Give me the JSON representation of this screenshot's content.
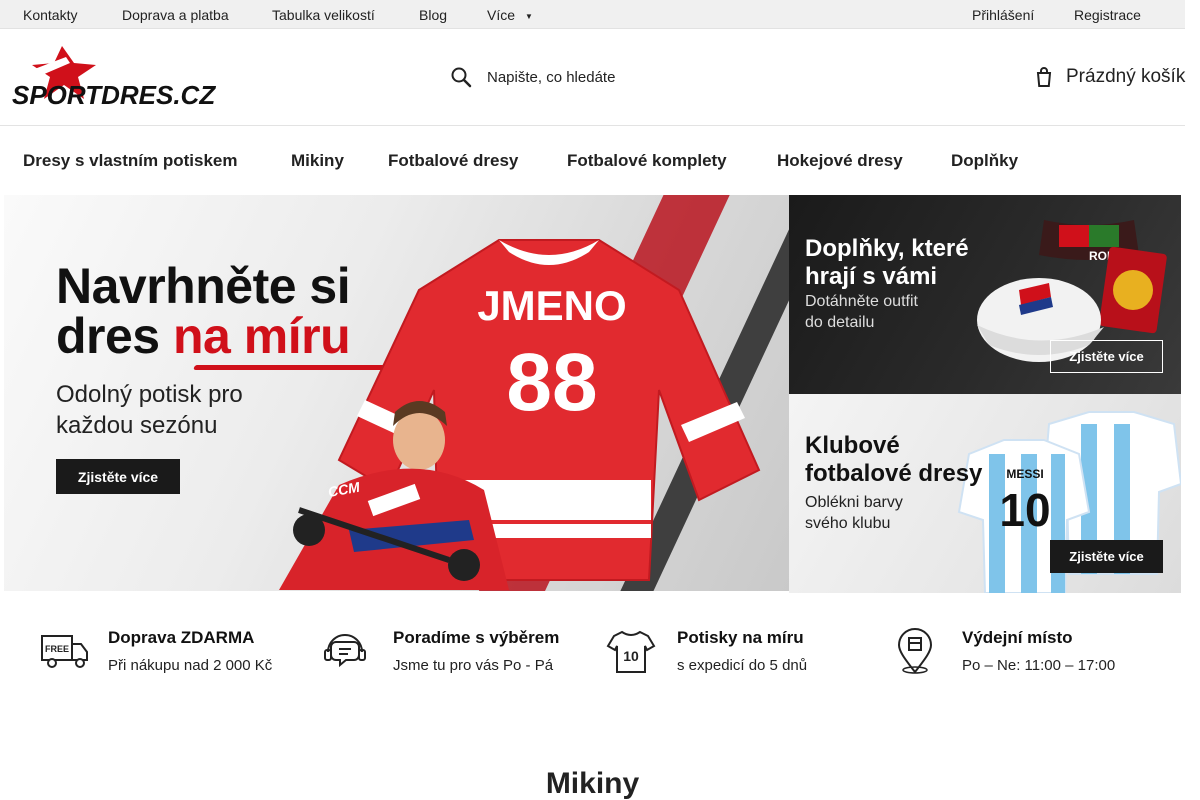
{
  "topbar": {
    "links": [
      "Kontakty",
      "Doprava a platba",
      "Tabulka velikostí",
      "Blog",
      "Více"
    ],
    "account": [
      "Přihlášení",
      "Registrace"
    ]
  },
  "header": {
    "logo_text": "SPORTDRES.CZ",
    "search_placeholder": "Napište, co hledáte",
    "cart_label": "Prázdný košík",
    "icons": [
      "search-icon",
      "cart-icon"
    ]
  },
  "categories": [
    "Dresy s vlastním potiskem",
    "Mikiny",
    "Fotbalové dresy",
    "Fotbalové komplety",
    "Hokejové dresy",
    "Doplňky"
  ],
  "hero": {
    "title_line1": "Navrhněte si",
    "title_line2_a": "dres ",
    "title_line2_b": "na míru",
    "subtitle": "Odolný potisk pro každou sezónu",
    "button": "Zjistěte více",
    "jersey_name": "JMENO",
    "jersey_number": "88",
    "stick_brand": "CCM"
  },
  "side_banners": [
    {
      "title": "Doplňky, které hrají s vámi",
      "text": "Dotáhněte outfit do detailu",
      "button": "Zjistěte více",
      "product_text": "RONALDO"
    },
    {
      "title": "Klubové fotbalové dresy",
      "text": "Oblékni barvy svého klubu",
      "button": "Zjistěte více",
      "product_name": "MESSI",
      "product_number": "10"
    }
  ],
  "benefits": [
    {
      "title": "Doprava ZDARMA",
      "text": "Při nákupu nad 2 000 Kč",
      "icon": "truck-icon",
      "icon_label": "FREE"
    },
    {
      "title": "Poradíme s výběrem",
      "text": "Jsme tu pro vás Po - Pá",
      "icon": "support-icon"
    },
    {
      "title": "Potisky na míru",
      "text": "s expedicí do 5 dnů",
      "icon": "jersey-icon",
      "icon_label": "10"
    },
    {
      "title": "Výdejní místo",
      "text": "Po – Ne: 11:00 – 17:00",
      "icon": "location-icon"
    }
  ],
  "section_title": "Mikiny",
  "colors": {
    "accent": "#d0101a",
    "dark": "#1a1a1a",
    "topbar": "#f0f0f0"
  }
}
